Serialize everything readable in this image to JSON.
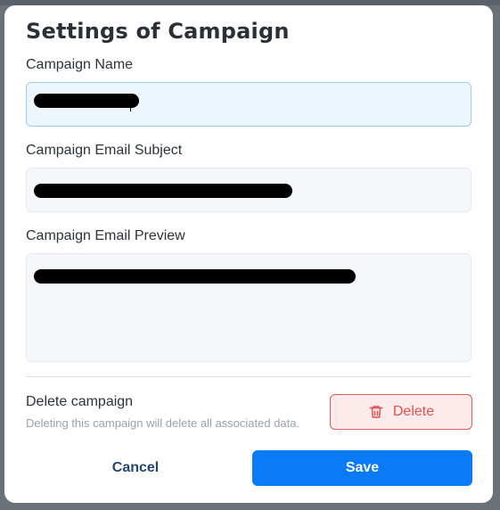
{
  "dialog": {
    "title": "Settings of Campaign",
    "fields": {
      "name_label": "Campaign Name",
      "subject_label": "Campaign Email Subject",
      "preview_label": "Campaign Email Preview"
    },
    "delete_section": {
      "title": "Delete campaign",
      "description": "Deleting this campaign will delete all associated data.",
      "button_label": "Delete",
      "button_icon": "trash-icon"
    },
    "actions": {
      "cancel_label": "Cancel",
      "save_label": "Save"
    }
  },
  "colors": {
    "primary": "#0a7bf5",
    "danger": "#e35050",
    "danger_bg": "#fdeaea"
  }
}
